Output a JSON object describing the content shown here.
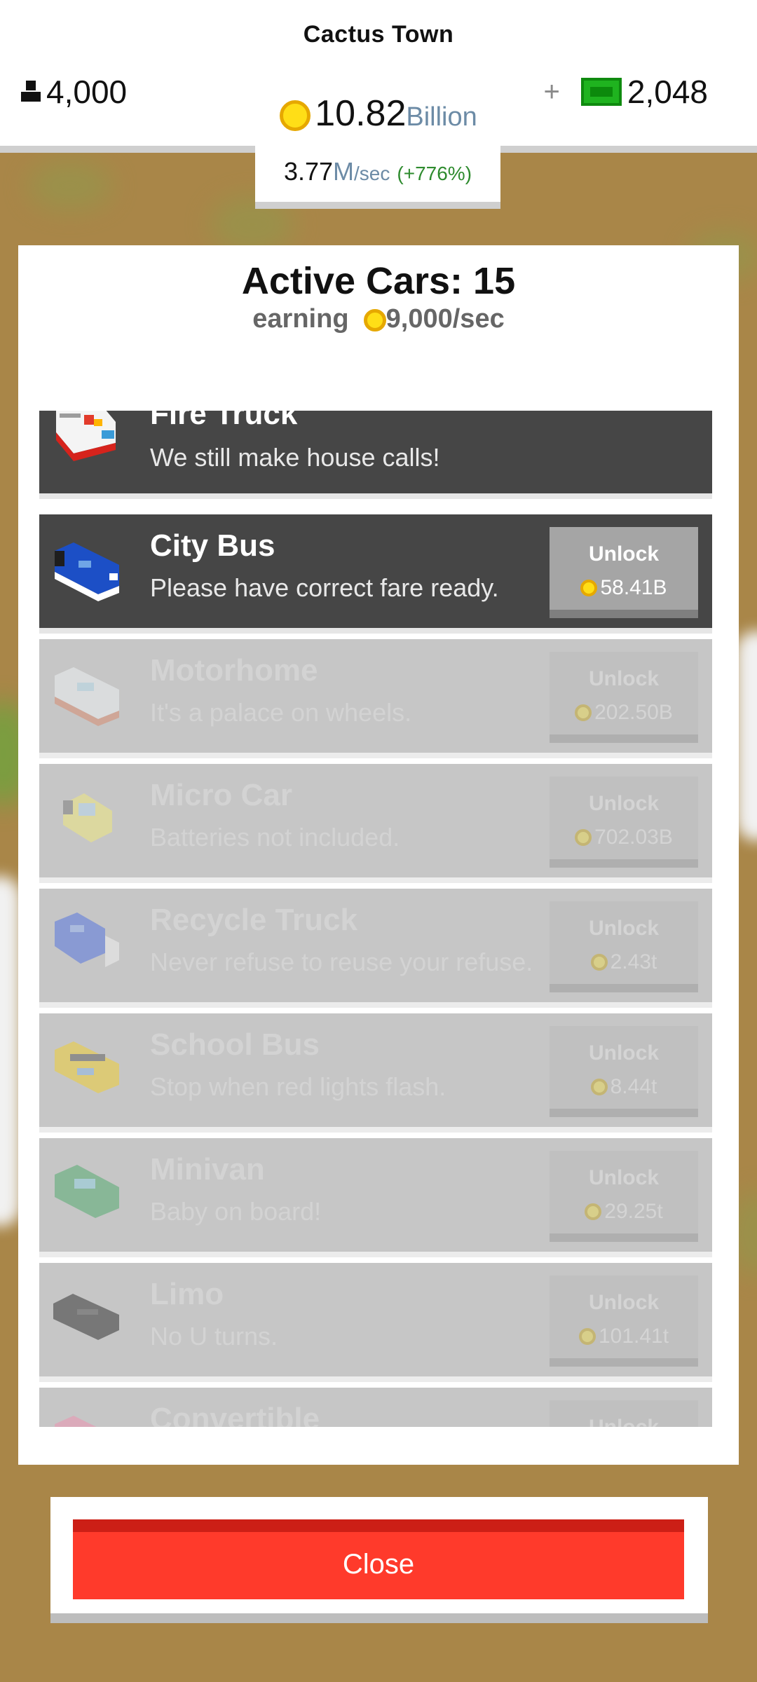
{
  "header": {
    "town_name": "Cactus Town",
    "population": "4,000",
    "coins_value": "10.82",
    "coins_unit": "Billion",
    "cash_plus": "+",
    "cash": "2,048",
    "rate_value": "3.77",
    "rate_unit": "M",
    "rate_suffix": "/sec",
    "rate_percent": "(+776%)"
  },
  "panel": {
    "title": "Active Cars: 15",
    "earning_label": "earning",
    "earning_rate": "9,000/sec"
  },
  "cars": [
    {
      "name": "Fire Truck",
      "desc": "We still make house calls!",
      "state": "owned",
      "icon": "fire-truck-icon"
    },
    {
      "name": "City Bus",
      "desc": "Please have correct fare ready.",
      "state": "available",
      "unlock": "Unlock",
      "price": "58.41B",
      "icon": "city-bus-icon"
    },
    {
      "name": "Motorhome",
      "desc": "It's a palace on wheels.",
      "state": "locked",
      "unlock": "Unlock",
      "price": "202.50B",
      "icon": "motorhome-icon"
    },
    {
      "name": "Micro Car",
      "desc": "Batteries not included.",
      "state": "locked",
      "unlock": "Unlock",
      "price": "702.03B",
      "icon": "micro-car-icon"
    },
    {
      "name": "Recycle Truck",
      "desc": "Never refuse to reuse your refuse.",
      "state": "locked",
      "unlock": "Unlock",
      "price": "2.43t",
      "icon": "recycle-truck-icon"
    },
    {
      "name": "School Bus",
      "desc": "Stop when red lights flash.",
      "state": "locked",
      "unlock": "Unlock",
      "price": "8.44t",
      "icon": "school-bus-icon"
    },
    {
      "name": "Minivan",
      "desc": "Baby on board!",
      "state": "locked",
      "unlock": "Unlock",
      "price": "29.25t",
      "icon": "minivan-icon"
    },
    {
      "name": "Limo",
      "desc": "No U turns.",
      "state": "locked",
      "unlock": "Unlock",
      "price": "101.41t",
      "icon": "limo-icon"
    },
    {
      "name": "Convertible",
      "desc": "",
      "state": "locked",
      "unlock": "Unlock",
      "price": "",
      "icon": "convertible-icon"
    }
  ],
  "close_label": "Close",
  "colors": {
    "accent_red": "#ff3a2b",
    "coin_yellow": "#ffde17",
    "cash_green": "#1fb31f",
    "percent_green": "#2e8b2e",
    "unit_blue": "#6c8ba6"
  }
}
